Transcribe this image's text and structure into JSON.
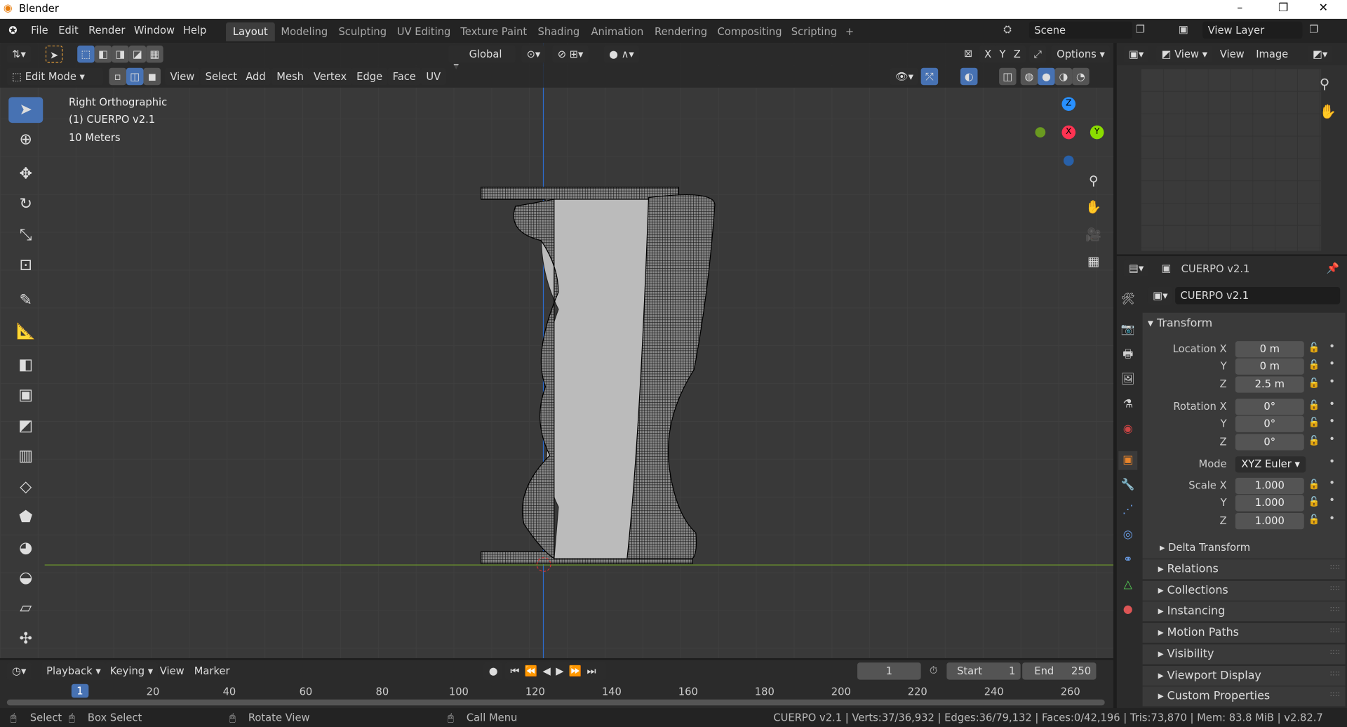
{
  "window": {
    "title": "Blender",
    "controls": [
      "–",
      "❐",
      "✕"
    ]
  },
  "menu": [
    "File",
    "Edit",
    "Render",
    "Window",
    "Help"
  ],
  "workspaces": [
    "Layout",
    "Modeling",
    "Sculpting",
    "UV Editing",
    "Texture Paint",
    "Shading",
    "Animation",
    "Rendering",
    "Compositing",
    "Scripting",
    "+"
  ],
  "active_workspace": "Layout",
  "scene": "Scene",
  "view_layer": "View Layer",
  "viewport": {
    "transform_orientation": "Global",
    "options": "Options",
    "axes": [
      "X",
      "Y",
      "Z"
    ],
    "mode": "Edit Mode",
    "menus": [
      "View",
      "Select",
      "Add",
      "Mesh",
      "Vertex",
      "Edge",
      "Face",
      "UV"
    ],
    "overlay": [
      "Right Orthographic",
      "(1) CUERPO v2.1",
      "10 Meters"
    ],
    "gizmo": {
      "z": "Z",
      "x": "X",
      "y": "Y",
      "colors": {
        "x": "#ff3352",
        "y": "#8bdc00",
        "z": "#2890ff"
      }
    }
  },
  "image_editor": {
    "menus": [
      "View",
      "View",
      "Image"
    ]
  },
  "properties": {
    "object_name": "CUERPO v2.1",
    "data_name": "CUERPO v2.1",
    "transform": {
      "title": "Transform",
      "rows": [
        {
          "label": "Location X",
          "value": "0 m"
        },
        {
          "label": "Y",
          "value": "0 m"
        },
        {
          "label": "Z",
          "value": "2.5 m"
        },
        {
          "label": "Rotation X",
          "value": "0°"
        },
        {
          "label": "Y",
          "value": "0°"
        },
        {
          "label": "Z",
          "value": "0°"
        },
        {
          "label": "Mode",
          "value": "XYZ Euler"
        },
        {
          "label": "Scale X",
          "value": "1.000"
        },
        {
          "label": "Y",
          "value": "1.000"
        },
        {
          "label": "Z",
          "value": "1.000"
        }
      ],
      "delta": "Delta Transform"
    },
    "sections": [
      "Relations",
      "Collections",
      "Instancing",
      "Motion Paths",
      "Visibility",
      "Viewport Display",
      "Custom Properties"
    ]
  },
  "timeline": {
    "menus": [
      "Playback",
      "Keying",
      "View",
      "Marker"
    ],
    "current_frame": "1",
    "start_label": "Start",
    "start": "1",
    "end_label": "End",
    "end": "250",
    "ticks": [
      "1",
      "20",
      "40",
      "60",
      "80",
      "100",
      "120",
      "140",
      "160",
      "180",
      "200",
      "220",
      "240",
      "260"
    ]
  },
  "statusbar": {
    "items": [
      "Select",
      "Box Select",
      "Rotate View",
      "Call Menu"
    ],
    "info": "CUERPO v2.1 | Verts:37/36,932 | Edges:36/79,132 | Faces:0/42,196 | Tris:73,870 | Mem: 83.8 MiB | v2.82.7"
  },
  "colors": {
    "accent": "#4772b3",
    "viewport_bg": "#393939"
  }
}
